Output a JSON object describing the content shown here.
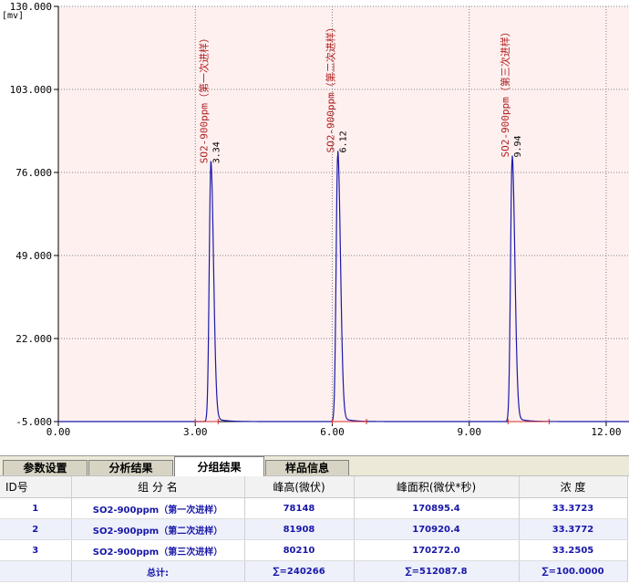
{
  "chart_data": {
    "type": "line",
    "y_unit_label": "[mv]",
    "x_ticks": [
      "0.00",
      "3.00",
      "6.00",
      "9.00",
      "12.00"
    ],
    "y_ticks": [
      "-5.000",
      "22.000",
      "49.000",
      "76.000",
      "103.000",
      "130.000"
    ],
    "xlim": [
      0,
      12.5
    ],
    "ylim": [
      -5,
      130
    ],
    "baseline": -5,
    "peak_shape": {
      "width": 0.1,
      "tail": 0.2
    },
    "peaks": [
      {
        "rt": 3.34,
        "rt_label": "3.34",
        "height": 78,
        "start": 3.0,
        "end": 3.5,
        "name": "SO2-900ppm（第一次进样）"
      },
      {
        "rt": 6.12,
        "rt_label": "6.12",
        "height": 81.5,
        "start": 6.0,
        "end": 6.75,
        "name": "SO2-900ppm（第二次进样）"
      },
      {
        "rt": 9.94,
        "rt_label": "9.94",
        "height": 80,
        "start": 9.85,
        "end": 10.75,
        "name": "SO2-900ppm（第三次进样）"
      }
    ],
    "colors": {
      "trace": "#1a1aa8",
      "grid": "#7f7f7f",
      "plot_bg": "#fff0f0",
      "marker": "#d42a2a",
      "label": "#b02020"
    },
    "grid": true
  },
  "tabs": [
    {
      "label": "参数设置",
      "active": false
    },
    {
      "label": "分析结果",
      "active": false
    },
    {
      "label": "分组结果",
      "active": true
    },
    {
      "label": "样品信息",
      "active": false
    }
  ],
  "table": {
    "headers": [
      "ID号",
      "组 分 名",
      "峰高(微伏)",
      "峰面积(微伏*秒)",
      "浓  度"
    ],
    "rows": [
      [
        "1",
        "SO2-900ppm（第一次进样）",
        "78148",
        "170895.4",
        "33.3723"
      ],
      [
        "2",
        "SO2-900ppm（第二次进样）",
        "81908",
        "170920.4",
        "33.3772"
      ],
      [
        "3",
        "SO2-900ppm（第三次进样）",
        "80210",
        "170272.0",
        "33.2505"
      ]
    ],
    "totals": [
      "",
      "总计:",
      "∑=240266",
      "∑=512087.8",
      "∑=100.0000"
    ]
  }
}
